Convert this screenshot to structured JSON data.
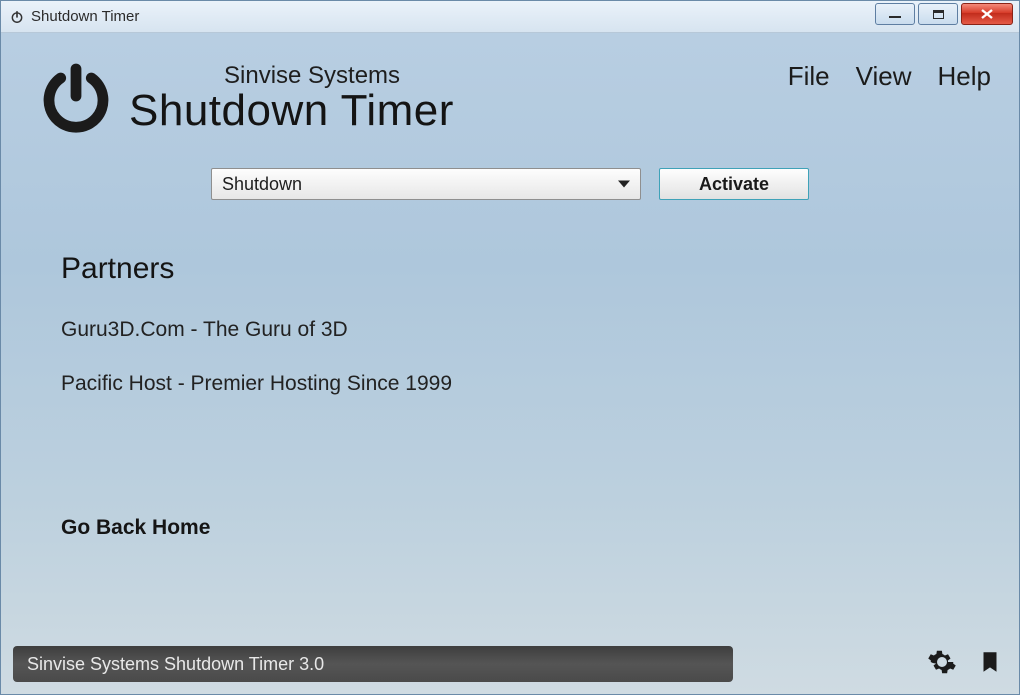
{
  "window": {
    "title": "Shutdown Timer"
  },
  "header": {
    "company": "Sinvise Systems",
    "app_title": "Shutdown Timer"
  },
  "menu": {
    "file": "File",
    "view": "View",
    "help": "Help"
  },
  "action": {
    "dropdown_value": "Shutdown",
    "activate_label": "Activate"
  },
  "content": {
    "section_title": "Partners",
    "partners": [
      "Guru3D.Com - The Guru of 3D",
      "Pacific Host - Premier Hosting Since 1999"
    ],
    "go_back_label": "Go Back Home"
  },
  "statusbar": {
    "text": "Sinvise Systems Shutdown Timer 3.0"
  },
  "colors": {
    "close_red": "#d63b28",
    "text_dark": "#141414",
    "status_bg": "#4a4a4a"
  }
}
